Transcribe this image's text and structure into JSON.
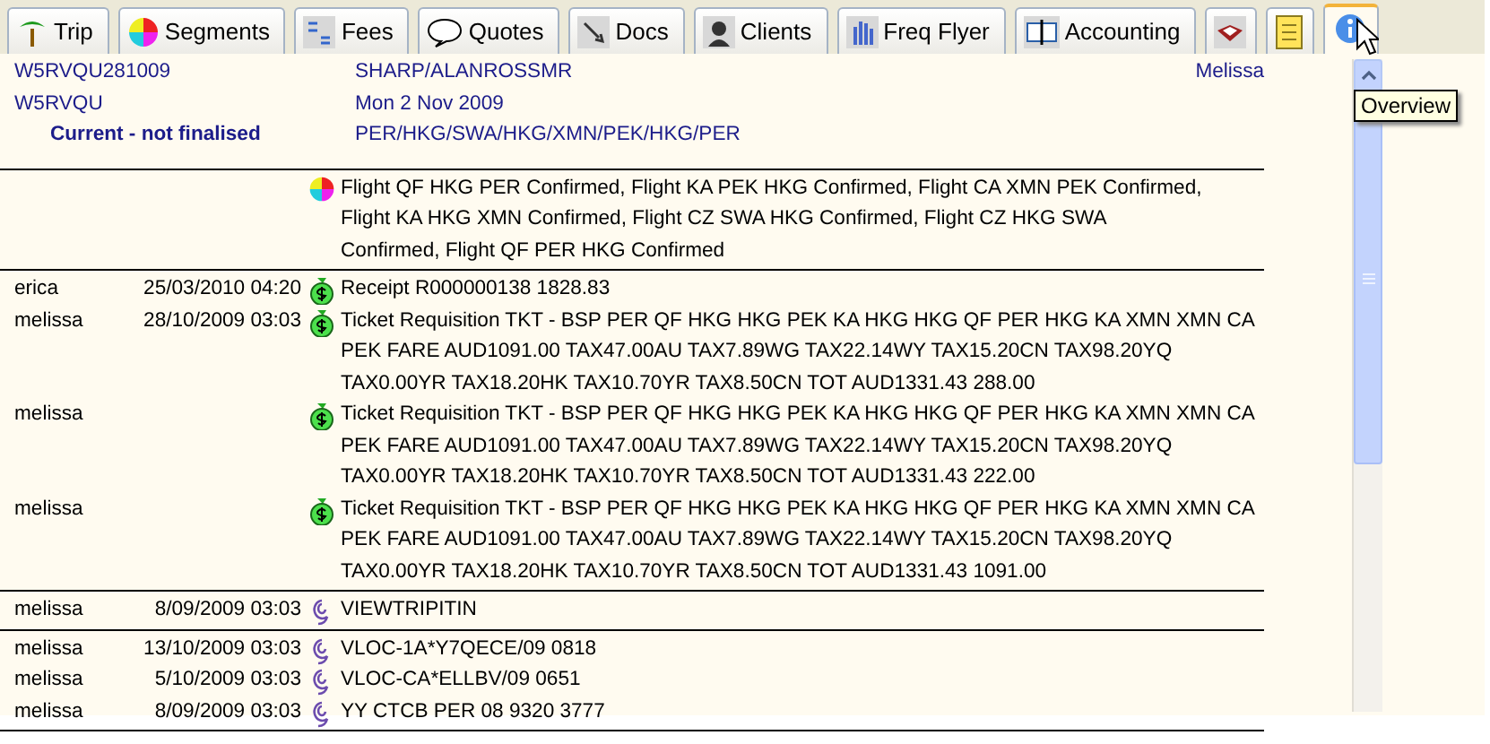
{
  "tabs": [
    {
      "label": "Trip",
      "selected": false
    },
    {
      "label": "Segments",
      "selected": false
    },
    {
      "label": "Fees",
      "selected": false
    },
    {
      "label": "Quotes",
      "selected": false
    },
    {
      "label": "Docs",
      "selected": false
    },
    {
      "label": "Clients",
      "selected": false
    },
    {
      "label": "Freq Flyer",
      "selected": false
    },
    {
      "label": "Accounting",
      "selected": false
    },
    {
      "selected": false
    },
    {
      "selected": false
    },
    {
      "selected": true
    }
  ],
  "tooltip": "Overview",
  "header": {
    "record": "W5RVQU281009",
    "passenger": "SHARP/ALANROSSMR",
    "agent": "Melissa",
    "locator": "W5RVQU",
    "date": "Mon 2 Nov 2009",
    "status": "Current - not finalised",
    "route": "PER/HKG/SWA/HKG/XMN/PEK/HKG/PER"
  },
  "sections": [
    {
      "entries": [
        {
          "kind": "segments",
          "lines": [
            "Flight QF HKG PER Confirmed, Flight KA PEK HKG Confirmed, Flight CA XMN PEK Confirmed,",
            "Flight KA HKG XMN Confirmed, Flight CZ SWA HKG Confirmed, Flight CZ HKG SWA",
            "Confirmed, Flight QF PER HKG Confirmed"
          ]
        }
      ]
    },
    {
      "entries": [
        {
          "kind": "money",
          "user": "erica",
          "date": "25/03/2010 04:20",
          "lines": [
            "Receipt R000000138  1828.83"
          ]
        },
        {
          "kind": "money",
          "user": "melissa",
          "date": "28/10/2009 03:03",
          "lines": [
            "Ticket Requisition TKT - BSP PER QF HKG HKG PEK KA HKG HKG QF PER HKG KA XMN XMN CA",
            "PEK FARE AUD1091.00 TAX47.00AU TAX7.89WG TAX22.14WY TAX15.20CN TAX98.20YQ",
            "TAX0.00YR TAX18.20HK TAX10.70YR TAX8.50CN TOT AUD1331.43 288.00"
          ]
        },
        {
          "kind": "money",
          "user": "melissa",
          "lines": [
            "Ticket Requisition TKT - BSP PER QF HKG HKG PEK KA HKG HKG QF PER HKG KA XMN XMN CA",
            "PEK FARE AUD1091.00 TAX47.00AU TAX7.89WG TAX22.14WY TAX15.20CN TAX98.20YQ",
            "TAX0.00YR TAX18.20HK TAX10.70YR TAX8.50CN TOT AUD1331.43 222.00"
          ]
        },
        {
          "kind": "money",
          "user": "melissa",
          "lines": [
            "Ticket Requisition TKT - BSP PER QF HKG HKG PEK KA HKG HKG QF PER HKG KA XMN XMN CA",
            "PEK FARE AUD1091.00 TAX47.00AU TAX7.89WG TAX22.14WY TAX15.20CN TAX98.20YQ",
            "TAX0.00YR TAX18.20HK TAX10.70YR TAX8.50CN TOT AUD1331.43 1091.00"
          ]
        }
      ]
    },
    {
      "entries": [
        {
          "kind": "remark",
          "user": "melissa",
          "date": "8/09/2009 03:03",
          "lines": [
            "VIEWTRIPITIN"
          ]
        }
      ]
    },
    {
      "entries": [
        {
          "kind": "remark",
          "user": "melissa",
          "date": "13/10/2009 03:03",
          "lines": [
            "VLOC-1A*Y7QECE/09 0818"
          ]
        },
        {
          "kind": "remark",
          "user": "melissa",
          "date": "5/10/2009 03:03",
          "lines": [
            "VLOC-CA*ELLBV/09 0651"
          ]
        },
        {
          "kind": "remark",
          "user": "melissa",
          "date": "8/09/2009 03:03",
          "lines": [
            "YY    CTCB PER 08 9320 3777"
          ]
        }
      ]
    }
  ]
}
